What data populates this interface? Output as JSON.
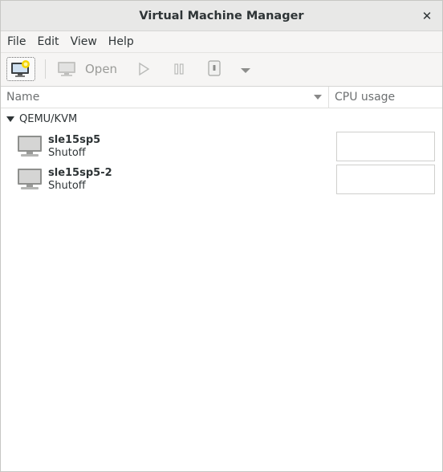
{
  "window": {
    "title": "Virtual Machine Manager"
  },
  "menu": [
    "File",
    "Edit",
    "View",
    "Help"
  ],
  "toolbar": {
    "open_label": "Open"
  },
  "columns": {
    "name": "Name",
    "cpu": "CPU usage"
  },
  "group": {
    "label": "QEMU/KVM"
  },
  "vms": [
    {
      "name": "sle15sp5",
      "status": "Shutoff"
    },
    {
      "name": "sle15sp5-2",
      "status": "Shutoff"
    }
  ],
  "colors": {
    "disabled": "#9a9b98",
    "text": "#2e3436",
    "header_text": "#6d7071"
  }
}
